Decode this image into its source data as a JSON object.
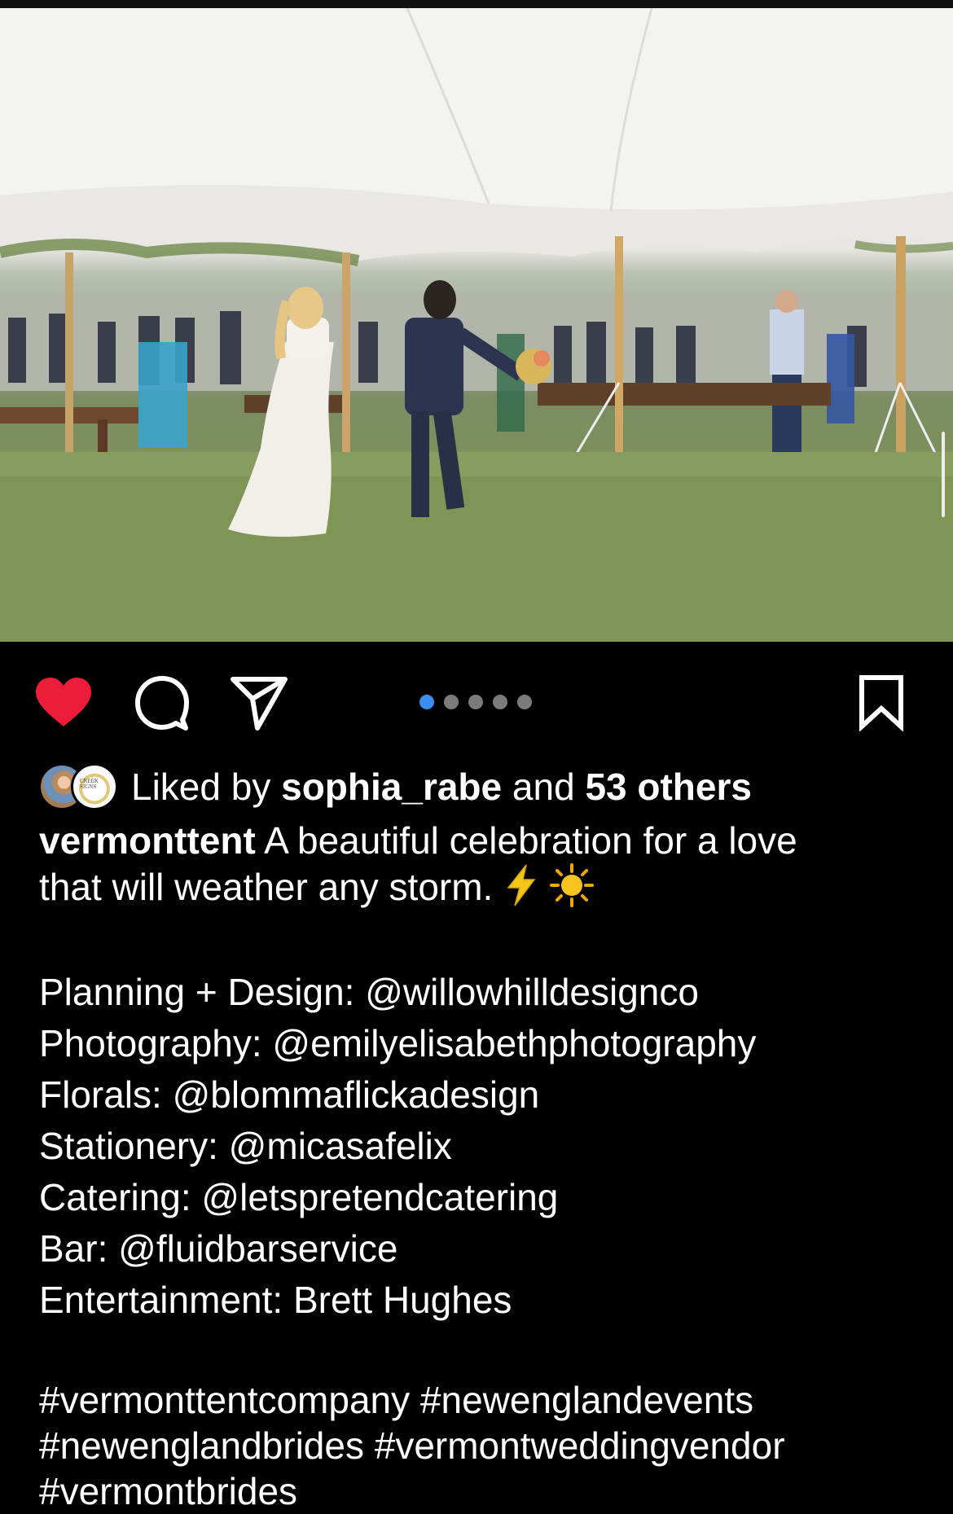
{
  "post": {
    "image_alt": "Bride and groom running across lawn toward guests under a white tent",
    "carousel": {
      "count": 5,
      "active_index": 0
    }
  },
  "icons": {
    "like": "heart-filled-icon",
    "comment": "comment-bubble-icon",
    "share": "paper-plane-icon",
    "save": "bookmark-icon"
  },
  "colors": {
    "like": "#ed1c3b",
    "carousel_active": "#3a8ef0"
  },
  "likes": {
    "prefix": "Liked by",
    "user": "sophia_rabe",
    "joiner": "and",
    "others": "53 others"
  },
  "caption": {
    "username": "vermonttent",
    "line1": "A beautiful celebration for a love",
    "line2": "that will weather any storm.",
    "credits": [
      "Planning + Design: @willowhilldesignco",
      "Photography:  @emilyelisabethphotography",
      "Florals: @blommaflickadesign",
      "Stationery: @micasafelix",
      "Catering: @letspretendcatering",
      "Bar: @fluidbarservice",
      "Entertainment: Brett Hughes"
    ],
    "hashtags": [
      "#vermonttentcompany #newenglandevents",
      "#newenglandbrides #vermontweddingvendor",
      "#vermontbrides"
    ]
  }
}
